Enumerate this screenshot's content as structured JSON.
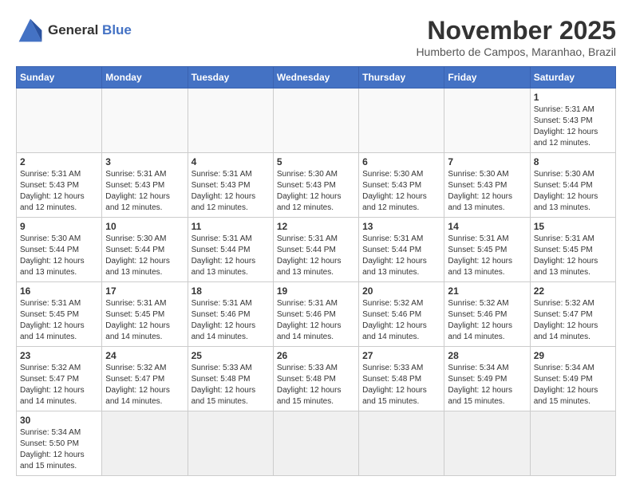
{
  "header": {
    "logo_line1": "General",
    "logo_line2": "Blue",
    "month_year": "November 2025",
    "location": "Humberto de Campos, Maranhao, Brazil"
  },
  "weekdays": [
    "Sunday",
    "Monday",
    "Tuesday",
    "Wednesday",
    "Thursday",
    "Friday",
    "Saturday"
  ],
  "weeks": [
    [
      {
        "day": "",
        "info": ""
      },
      {
        "day": "",
        "info": ""
      },
      {
        "day": "",
        "info": ""
      },
      {
        "day": "",
        "info": ""
      },
      {
        "day": "",
        "info": ""
      },
      {
        "day": "",
        "info": ""
      },
      {
        "day": "1",
        "info": "Sunrise: 5:31 AM\nSunset: 5:43 PM\nDaylight: 12 hours\nand 12 minutes."
      }
    ],
    [
      {
        "day": "2",
        "info": "Sunrise: 5:31 AM\nSunset: 5:43 PM\nDaylight: 12 hours\nand 12 minutes."
      },
      {
        "day": "3",
        "info": "Sunrise: 5:31 AM\nSunset: 5:43 PM\nDaylight: 12 hours\nand 12 minutes."
      },
      {
        "day": "4",
        "info": "Sunrise: 5:31 AM\nSunset: 5:43 PM\nDaylight: 12 hours\nand 12 minutes."
      },
      {
        "day": "5",
        "info": "Sunrise: 5:30 AM\nSunset: 5:43 PM\nDaylight: 12 hours\nand 12 minutes."
      },
      {
        "day": "6",
        "info": "Sunrise: 5:30 AM\nSunset: 5:43 PM\nDaylight: 12 hours\nand 12 minutes."
      },
      {
        "day": "7",
        "info": "Sunrise: 5:30 AM\nSunset: 5:43 PM\nDaylight: 12 hours\nand 13 minutes."
      },
      {
        "day": "8",
        "info": "Sunrise: 5:30 AM\nSunset: 5:44 PM\nDaylight: 12 hours\nand 13 minutes."
      }
    ],
    [
      {
        "day": "9",
        "info": "Sunrise: 5:30 AM\nSunset: 5:44 PM\nDaylight: 12 hours\nand 13 minutes."
      },
      {
        "day": "10",
        "info": "Sunrise: 5:30 AM\nSunset: 5:44 PM\nDaylight: 12 hours\nand 13 minutes."
      },
      {
        "day": "11",
        "info": "Sunrise: 5:31 AM\nSunset: 5:44 PM\nDaylight: 12 hours\nand 13 minutes."
      },
      {
        "day": "12",
        "info": "Sunrise: 5:31 AM\nSunset: 5:44 PM\nDaylight: 12 hours\nand 13 minutes."
      },
      {
        "day": "13",
        "info": "Sunrise: 5:31 AM\nSunset: 5:44 PM\nDaylight: 12 hours\nand 13 minutes."
      },
      {
        "day": "14",
        "info": "Sunrise: 5:31 AM\nSunset: 5:45 PM\nDaylight: 12 hours\nand 13 minutes."
      },
      {
        "day": "15",
        "info": "Sunrise: 5:31 AM\nSunset: 5:45 PM\nDaylight: 12 hours\nand 13 minutes."
      }
    ],
    [
      {
        "day": "16",
        "info": "Sunrise: 5:31 AM\nSunset: 5:45 PM\nDaylight: 12 hours\nand 14 minutes."
      },
      {
        "day": "17",
        "info": "Sunrise: 5:31 AM\nSunset: 5:45 PM\nDaylight: 12 hours\nand 14 minutes."
      },
      {
        "day": "18",
        "info": "Sunrise: 5:31 AM\nSunset: 5:46 PM\nDaylight: 12 hours\nand 14 minutes."
      },
      {
        "day": "19",
        "info": "Sunrise: 5:31 AM\nSunset: 5:46 PM\nDaylight: 12 hours\nand 14 minutes."
      },
      {
        "day": "20",
        "info": "Sunrise: 5:32 AM\nSunset: 5:46 PM\nDaylight: 12 hours\nand 14 minutes."
      },
      {
        "day": "21",
        "info": "Sunrise: 5:32 AM\nSunset: 5:46 PM\nDaylight: 12 hours\nand 14 minutes."
      },
      {
        "day": "22",
        "info": "Sunrise: 5:32 AM\nSunset: 5:47 PM\nDaylight: 12 hours\nand 14 minutes."
      }
    ],
    [
      {
        "day": "23",
        "info": "Sunrise: 5:32 AM\nSunset: 5:47 PM\nDaylight: 12 hours\nand 14 minutes."
      },
      {
        "day": "24",
        "info": "Sunrise: 5:32 AM\nSunset: 5:47 PM\nDaylight: 12 hours\nand 14 minutes."
      },
      {
        "day": "25",
        "info": "Sunrise: 5:33 AM\nSunset: 5:48 PM\nDaylight: 12 hours\nand 15 minutes."
      },
      {
        "day": "26",
        "info": "Sunrise: 5:33 AM\nSunset: 5:48 PM\nDaylight: 12 hours\nand 15 minutes."
      },
      {
        "day": "27",
        "info": "Sunrise: 5:33 AM\nSunset: 5:48 PM\nDaylight: 12 hours\nand 15 minutes."
      },
      {
        "day": "28",
        "info": "Sunrise: 5:34 AM\nSunset: 5:49 PM\nDaylight: 12 hours\nand 15 minutes."
      },
      {
        "day": "29",
        "info": "Sunrise: 5:34 AM\nSunset: 5:49 PM\nDaylight: 12 hours\nand 15 minutes."
      }
    ],
    [
      {
        "day": "30",
        "info": "Sunrise: 5:34 AM\nSunset: 5:50 PM\nDaylight: 12 hours\nand 15 minutes."
      },
      {
        "day": "",
        "info": ""
      },
      {
        "day": "",
        "info": ""
      },
      {
        "day": "",
        "info": ""
      },
      {
        "day": "",
        "info": ""
      },
      {
        "day": "",
        "info": ""
      },
      {
        "day": "",
        "info": ""
      }
    ]
  ]
}
